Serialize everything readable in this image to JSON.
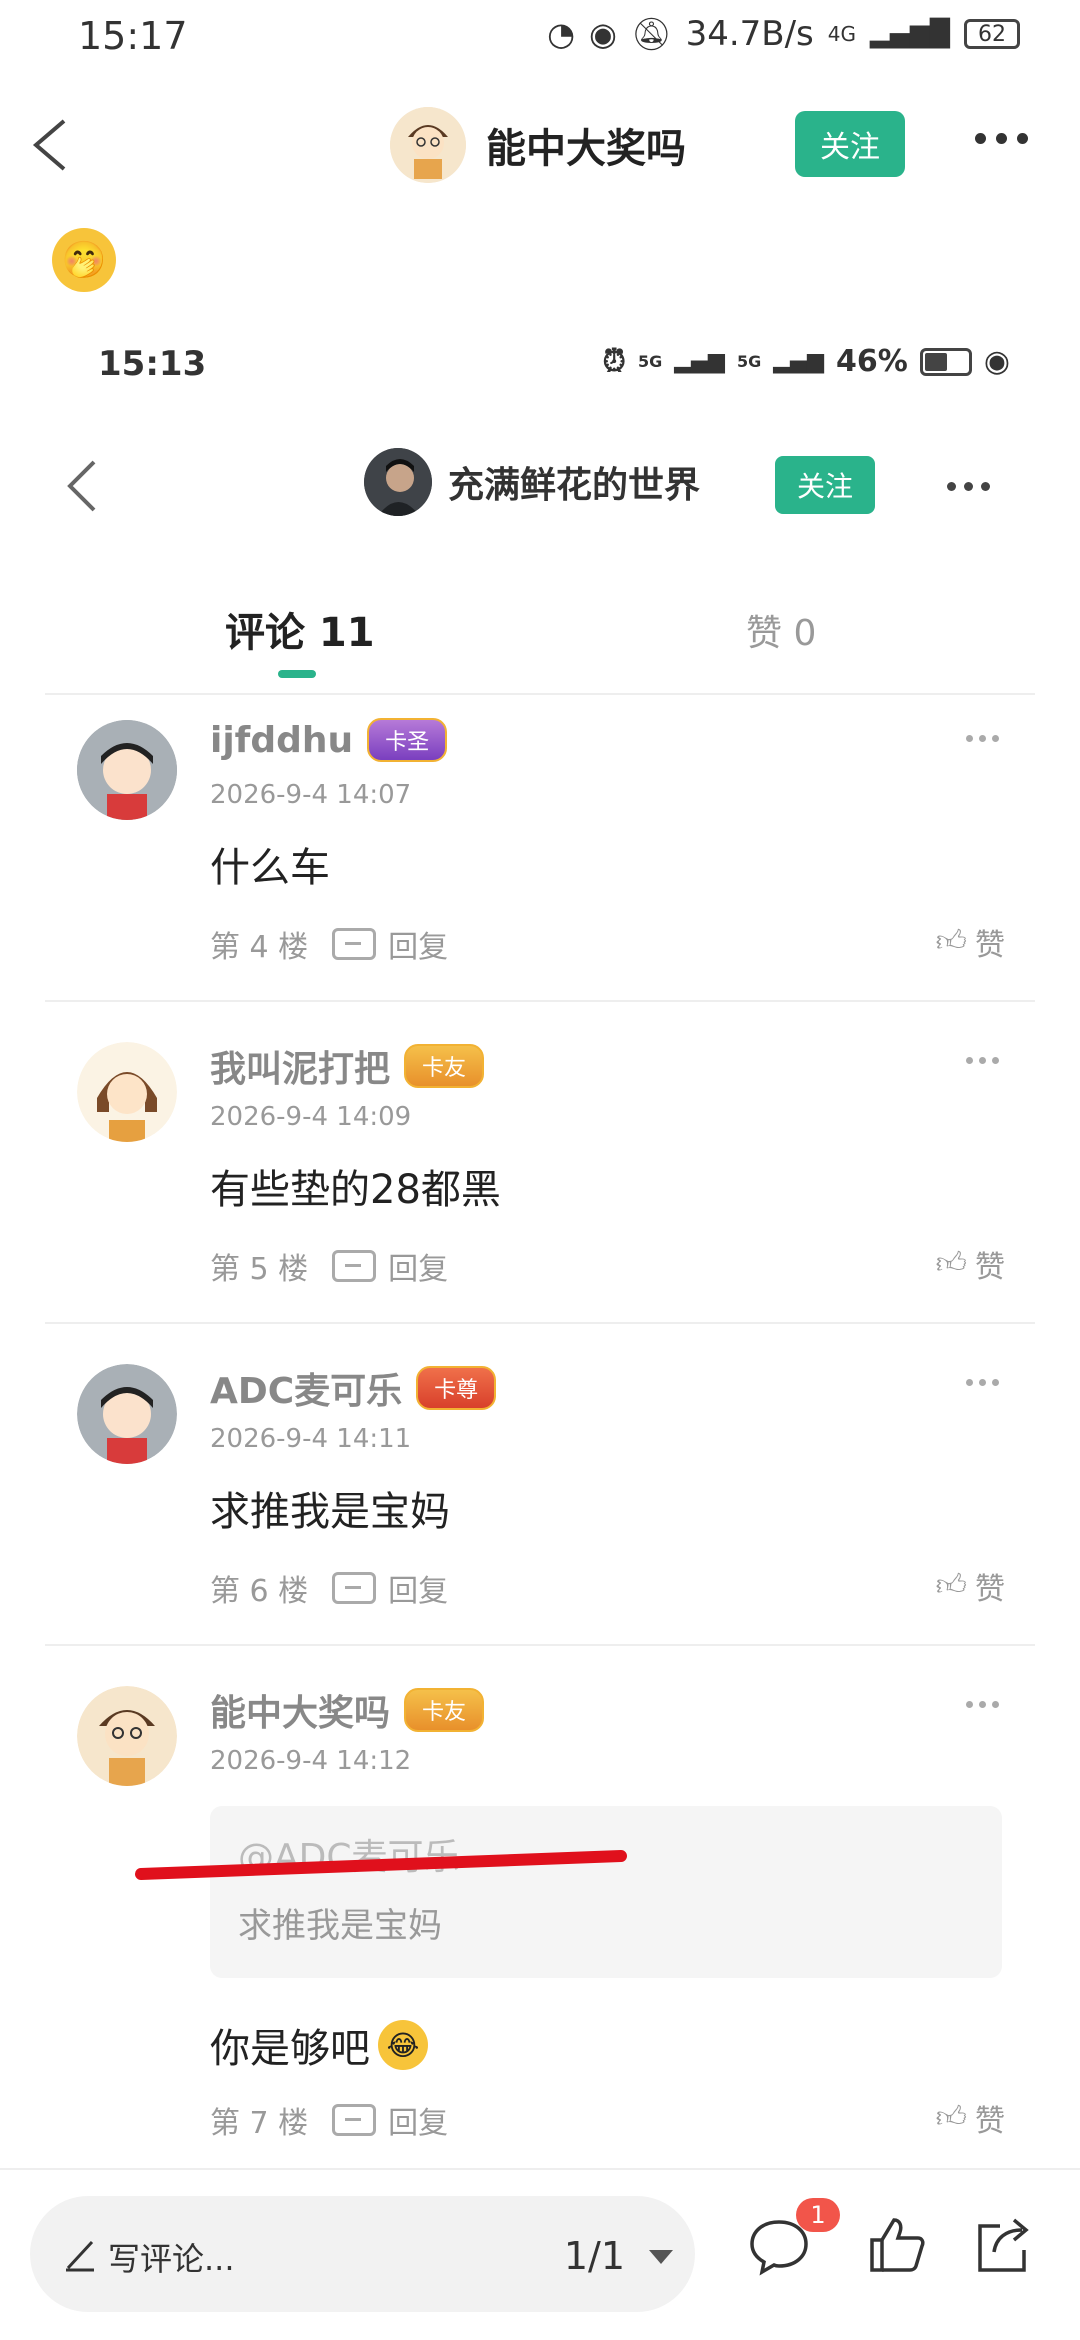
{
  "status_bar": {
    "time": "15:17",
    "net_speed": "34.7B/s",
    "signal": "4G",
    "battery": "62"
  },
  "nav": {
    "title": "能中大奖吗",
    "follow_label": "关注"
  },
  "post": {
    "emoji": "🤭"
  },
  "embedded": {
    "status_time": "15:13",
    "status_signal_1": "5G",
    "status_signal_2": "5G",
    "battery_percent": "46%",
    "nav_title": "充满鲜花的世界",
    "follow_label": "关注",
    "tabs": {
      "comments": "评论 11",
      "likes": "赞 0"
    },
    "comments": [
      {
        "username": "ijfddhu",
        "badge": "卡圣",
        "time": "2026-9-4 14:07",
        "text": "什么车",
        "floor": "第 4 楼",
        "reply_label": "回复",
        "like_label": "赞"
      },
      {
        "username": "我叫泥打把",
        "badge": "卡友",
        "time": "2026-9-4 14:09",
        "text": "有些垫的28都黑",
        "floor": "第 5 楼",
        "reply_label": "回复",
        "like_label": "赞"
      },
      {
        "username": "ADC麦可乐",
        "badge": "卡尊",
        "time": "2026-9-4 14:11",
        "text": "求推我是宝妈",
        "floor": "第 6 楼",
        "reply_label": "回复",
        "like_label": "赞"
      },
      {
        "username": "能中大奖吗",
        "badge": "卡友",
        "time": "2026-9-4 14:12",
        "quote_user": "@ADC麦可乐",
        "quote_text": "求推我是宝妈",
        "text": "你是够吧",
        "emoji": "😂",
        "floor": "第 7 楼",
        "reply_label": "回复",
        "like_label": "赞"
      }
    ]
  },
  "bottom_bar": {
    "placeholder": "写评论...",
    "page_counter": "1/1",
    "comment_badge": "1"
  },
  "colors": {
    "accent": "#2ab38b",
    "badge_red": "#f2554a",
    "annotation_red": "#e0101c"
  }
}
